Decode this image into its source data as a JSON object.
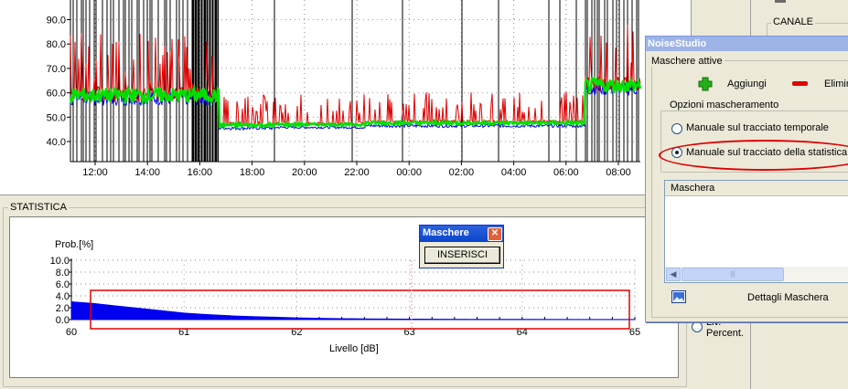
{
  "top_chart": {
    "y_ticks": [
      "90.0",
      "80.0",
      "70.0",
      "60.0",
      "50.0",
      "40.0"
    ],
    "x_ticks": [
      "12:00",
      "14:00",
      "16:00",
      "18:00",
      "20:00",
      "22:00",
      "00:00",
      "02:00",
      "04:00",
      "06:00",
      "08:00"
    ]
  },
  "statistica": {
    "label": "STATISTICA",
    "ylabel": "Prob.[%]",
    "xlabel": "Livello [dB]",
    "y_ticks": [
      "10.0",
      "8.0",
      "6.0",
      "4.0",
      "2.0",
      "0.0"
    ],
    "x_ticks": [
      "60",
      "61",
      "62",
      "63",
      "64",
      "65"
    ]
  },
  "chart_data": {
    "type": "area",
    "title": "",
    "xlabel": "Livello [dB]",
    "ylabel": "Prob.[%]",
    "xlim": [
      60,
      65
    ],
    "ylim": [
      0,
      10
    ],
    "grid": true,
    "series": [
      {
        "color": "#0000ee",
        "x": [
          60.0,
          60.2,
          60.4,
          60.6,
          60.8,
          61.0,
          61.2,
          61.4,
          61.6,
          61.8,
          62.0,
          62.2,
          62.4,
          62.6,
          62.8,
          63.0,
          63.5,
          64.0,
          64.5,
          65.0
        ],
        "y": [
          3.0,
          2.7,
          2.3,
          1.9,
          1.5,
          1.1,
          0.85,
          0.65,
          0.5,
          0.4,
          0.3,
          0.22,
          0.16,
          0.12,
          0.09,
          0.07,
          0.05,
          0.03,
          0.02,
          0.01
        ]
      }
    ]
  },
  "maschere_popup": {
    "title": "Maschere",
    "button": "INSERISCI"
  },
  "right_panel": {
    "canale_label": "CANALE",
    "liv_percent": "Liv.\nPercent."
  },
  "dialog": {
    "title": "NoiseStudio",
    "maschere_attive": "Maschere attive",
    "aggiungi": "Aggiungi",
    "elimina": "Elimin",
    "opzioni": "Opzioni mascheramento",
    "radio_temporale": "Manuale sul tracciato temporale",
    "radio_statistica": "Manuale sul tracciato della statistica",
    "list_header": "Maschera",
    "dettagli": "Dettagli Maschera"
  },
  "colors": {
    "accent_red": "#e00000",
    "series_green": "#00e000",
    "series_blue": "#0000ee",
    "titlebar": "#0a246a"
  }
}
